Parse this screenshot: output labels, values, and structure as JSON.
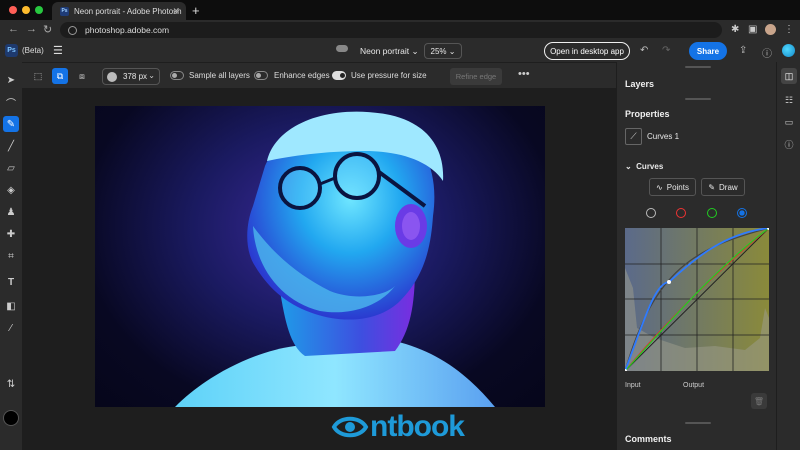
{
  "browser": {
    "tab_title": "Neon portrait - Adobe Photosh",
    "tab_favicon": "Ps",
    "url": "photoshop.adobe.com",
    "traffic_light_colors": [
      "#ff5f57",
      "#febc2e",
      "#28c840"
    ]
  },
  "app": {
    "logo": "Ps",
    "beta_label": "(Beta)",
    "document_name": "Neon portrait",
    "zoom": "25%",
    "open_desktop_label": "Open in desktop app",
    "share_label": "Share",
    "accent_color": "#1473e6"
  },
  "options_bar": {
    "brush_size": "378 px",
    "sample_all_layers_label": "Sample all layers",
    "sample_all_layers_on": false,
    "enhance_edges_label": "Enhance edges",
    "enhance_edges_on": false,
    "use_pressure_label": "Use pressure for size",
    "use_pressure_on": true,
    "refine_edge_label": "Refine edge"
  },
  "tools": [
    "select-icon",
    "lasso-icon",
    "quick-selection-icon",
    "brush-icon",
    "eraser-icon",
    "paint-bucket-icon",
    "clone-stamp-icon",
    "healing-brush-icon",
    "crop-icon",
    "type-icon",
    "shape-icon",
    "eyedropper-icon"
  ],
  "panel": {
    "layers_title": "Layers",
    "properties_title": "Properties",
    "adjustment_layer_name": "Curves 1",
    "curves_section_title": "Curves",
    "points_label": "Points",
    "draw_label": "Draw",
    "channels": [
      "rgb",
      "red",
      "green",
      "blue"
    ],
    "active_channel": "blue",
    "input_label": "Input",
    "output_label": "Output",
    "comments_title": "Comments"
  },
  "watermark": {
    "text": "ntbook",
    "color": "#1e9ad8"
  }
}
